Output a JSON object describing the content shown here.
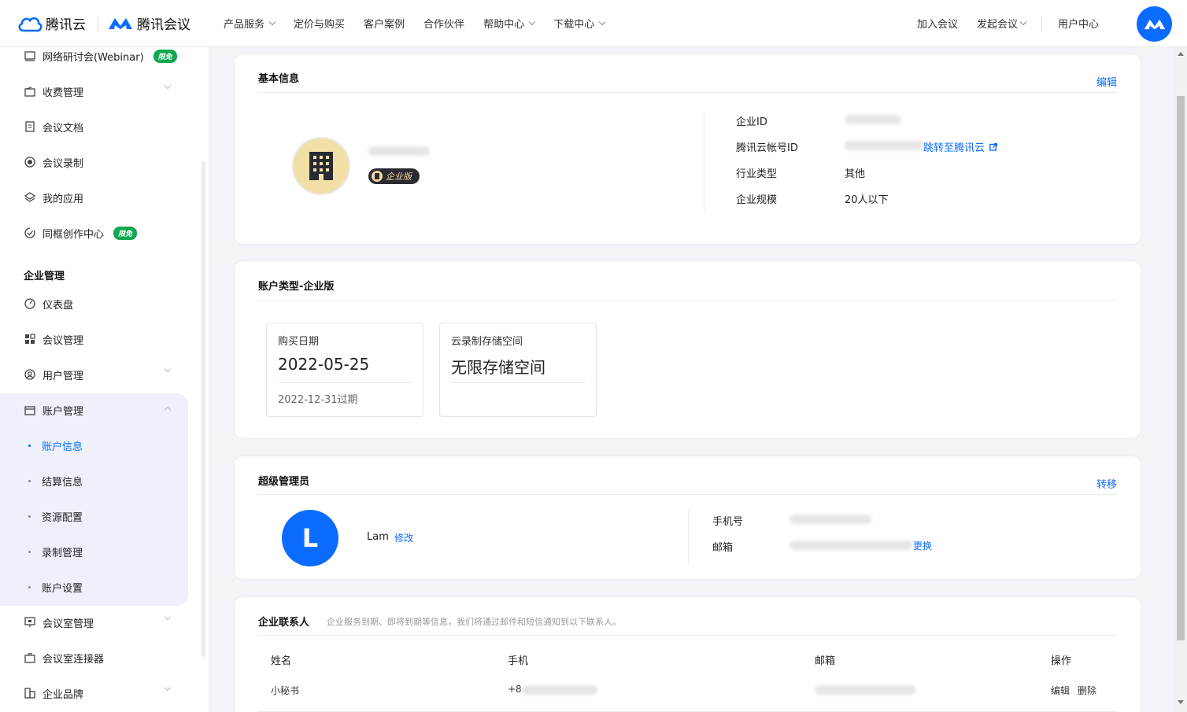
{
  "brand": {
    "cloud_name": "腾讯云",
    "meeting_name": "腾讯会议"
  },
  "nav": {
    "items": [
      "产品服务",
      "定价与购买",
      "客户案例",
      "合作伙伴",
      "帮助中心",
      "下载中心"
    ],
    "right": [
      "加入会议",
      "发起会议",
      "用户中心"
    ]
  },
  "sidebar": {
    "top_items": [
      {
        "label": "网络研讨会(Webinar)",
        "badge": "限免",
        "icon": "monitor-icon"
      },
      {
        "label": "收费管理",
        "icon": "wallet-icon"
      },
      {
        "label": "会议文档",
        "icon": "document-icon"
      },
      {
        "label": "会议录制",
        "icon": "record-icon"
      },
      {
        "label": "我的应用",
        "icon": "layers-icon"
      },
      {
        "label": "同框创作中心",
        "badge": "限免",
        "icon": "creative-icon"
      }
    ],
    "group_title": "企业管理",
    "group_items": [
      {
        "label": "仪表盘",
        "icon": "dashboard-icon"
      },
      {
        "label": "会议管理",
        "icon": "grid-icon"
      },
      {
        "label": "用户管理",
        "icon": "user-icon"
      },
      {
        "label": "账户管理",
        "icon": "account-icon"
      }
    ],
    "sub_items": [
      "账户信息",
      "结算信息",
      "资源配置",
      "录制管理",
      "账户设置"
    ],
    "bottom_items": [
      {
        "label": "会议室管理",
        "icon": "room-icon"
      },
      {
        "label": "会议室连接器",
        "icon": "connector-icon"
      },
      {
        "label": "企业品牌",
        "icon": "brand-icon"
      }
    ]
  },
  "basic_info": {
    "title": "基本信息",
    "edit": "编辑",
    "edition_badge": "企业版",
    "labels": [
      "企业ID",
      "腾讯云帐号ID",
      "行业类型",
      "企业规模"
    ],
    "industry": "其他",
    "scale": "20人以下",
    "jump_link": "跳转至腾讯云"
  },
  "account_type": {
    "title": "账户类型-企业版",
    "purchase_label": "购买日期",
    "purchase_date": "2022-05-25",
    "expire_text": "2022-12-31过期",
    "storage_label": "云录制存储空间",
    "storage_value": "无限存储空间"
  },
  "super_admin": {
    "title": "超级管理员",
    "transfer": "转移",
    "avatar_letter": "L",
    "name": "Lam",
    "modify": "修改",
    "phone_label": "手机号",
    "email_label": "邮箱",
    "change": "更换"
  },
  "contacts": {
    "title": "企业联系人",
    "desc": "企业服务到期、即将到期等信息，我们将通过邮件和短信通知到以下联系人。",
    "headers": [
      "姓名",
      "手机",
      "邮箱",
      "操作"
    ],
    "rows": [
      {
        "name": "小秘书",
        "phone_prefix": "+8",
        "edit": "编辑",
        "delete": "删除"
      }
    ]
  },
  "colors": {
    "accent": "#0a6cff",
    "badge_green": "#11a650",
    "badge_dark": "#2a2a33",
    "bg": "#f3f4f7"
  }
}
